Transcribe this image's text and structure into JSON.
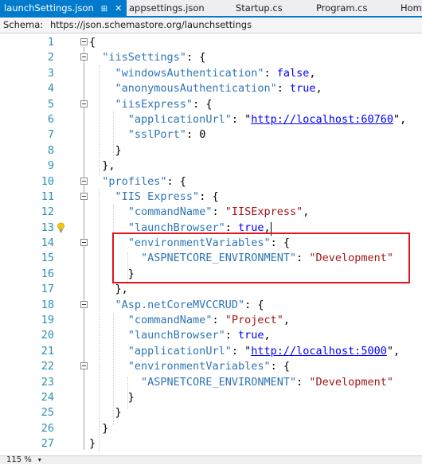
{
  "tabs": [
    {
      "label": "launchSettings.json",
      "pin": "⊞",
      "close": "✕",
      "active": true
    },
    {
      "label": "appsettings.json"
    },
    {
      "label": "Startup.cs"
    },
    {
      "label": "Program.cs"
    },
    {
      "label": "Home"
    }
  ],
  "schema": {
    "label": "Schema:",
    "url": "https://json.schemastore.org/launchsettings"
  },
  "editor": {
    "line_numbers": [
      "1",
      "2",
      "3",
      "4",
      "5",
      "6",
      "7",
      "8",
      "9",
      "10",
      "11",
      "12",
      "13",
      "14",
      "15",
      "16",
      "17",
      "18",
      "19",
      "20",
      "21",
      "22",
      "23",
      "24",
      "25",
      "26",
      "27"
    ],
    "code": {
      "l1_brace": "{",
      "l2_key": "\"iisSettings\"",
      "l2_rest": ": {",
      "l3_key": "\"windowsAuthentication\"",
      "l3_sep": ": ",
      "l3_val": "false",
      "l3_end": ",",
      "l4_key": "\"anonymousAuthentication\"",
      "l4_sep": ": ",
      "l4_val": "true",
      "l4_end": ",",
      "l5_key": "\"iisExpress\"",
      "l5_rest": ": {",
      "l6_key": "\"applicationUrl\"",
      "l6_sep": ": \"",
      "l6_url": "http://localhost:60760",
      "l6_end": "\",",
      "l7_key": "\"sslPort\"",
      "l7_sep": ": ",
      "l7_val": "0",
      "l8_brace": "}",
      "l9_brace": "},",
      "l10_key": "\"profiles\"",
      "l10_rest": ": {",
      "l11_key": "\"IIS Express\"",
      "l11_rest": ": {",
      "l12_key": "\"commandName\"",
      "l12_sep": ": ",
      "l12_val": "\"IISExpress\"",
      "l12_end": ",",
      "l13_key": "\"launchBrowser\"",
      "l13_sep": ": ",
      "l13_val": "true",
      "l13_end": ",",
      "l14_key": "\"environmentVariables\"",
      "l14_rest": ": {",
      "l15_key": "\"ASPNETCORE_ENVIRONMENT\"",
      "l15_sep": ": ",
      "l15_val": "\"Development\"",
      "l16_brace": "}",
      "l17_brace": "},",
      "l18_key": "\"Asp.netCoreMVCCRUD\"",
      "l18_rest": ": {",
      "l19_key": "\"commandName\"",
      "l19_sep": ": ",
      "l19_val": "\"Project\"",
      "l19_end": ",",
      "l20_key": "\"launchBrowser\"",
      "l20_sep": ": ",
      "l20_val": "true",
      "l20_end": ",",
      "l21_key": "\"applicationUrl\"",
      "l21_sep": ": \"",
      "l21_url": "http://localhost:5000",
      "l21_end": "\",",
      "l22_key": "\"environmentVariables\"",
      "l22_rest": ": {",
      "l23_key": "\"ASPNETCORE_ENVIRONMENT\"",
      "l23_sep": ": ",
      "l23_val": "\"Development\"",
      "l24_brace": "}",
      "l25_brace": "}",
      "l26_brace": "}",
      "l27_brace": "}"
    },
    "lightbulb_icon": "lightbulb-icon",
    "highlight_color": "#e0141e"
  },
  "status": {
    "zoom": "115 %",
    "zoom_arrow": "▾"
  },
  "colors": {
    "accent": "#007acc",
    "key": "#2e75b6",
    "string": "#a31515",
    "keyword": "#0000ff",
    "line_number": "#2b91af"
  }
}
